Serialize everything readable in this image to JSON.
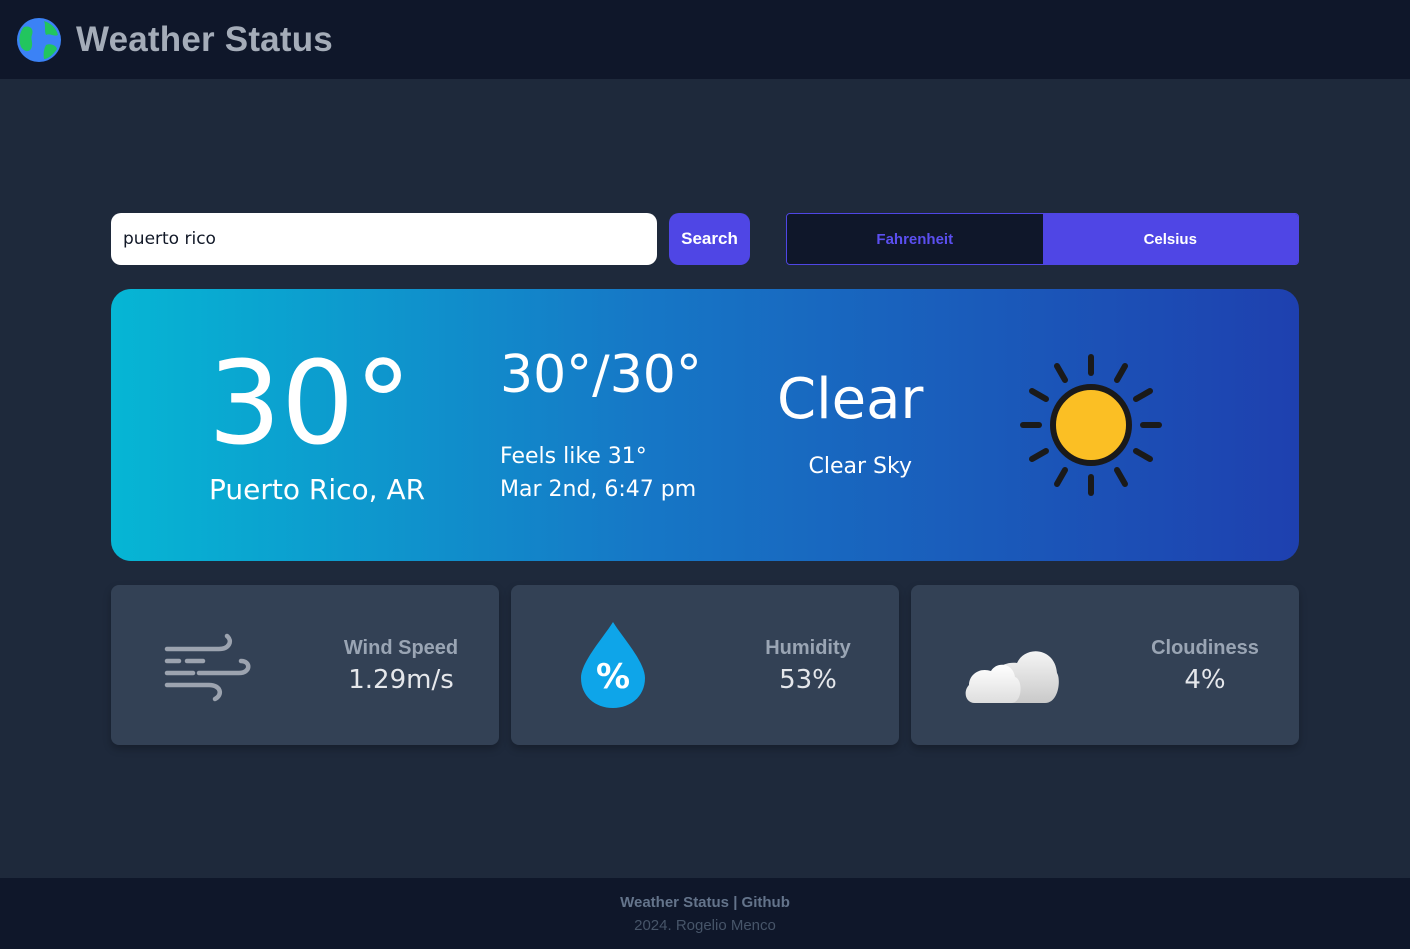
{
  "header": {
    "title": "Weather Status",
    "logo_icon": "globe-icon"
  },
  "search": {
    "value": "puerto rico",
    "button_label": "Search"
  },
  "units": {
    "options": [
      "Fahrenheit",
      "Celsius"
    ],
    "selected": "Celsius"
  },
  "current": {
    "temperature": "30°",
    "location": "Puerto Rico, AR",
    "range": "30°/30°",
    "feels_like": "Feels like 31°",
    "datetime": "Mar 2nd, 6:47 pm",
    "condition": "Clear",
    "condition_detail": "Clear Sky",
    "condition_icon": "sun-icon"
  },
  "stats": [
    {
      "label": "Wind Speed",
      "value": "1.29m/s",
      "icon": "wind-icon"
    },
    {
      "label": "Humidity",
      "value": "53%",
      "icon": "humidity-drop-icon"
    },
    {
      "label": "Cloudiness",
      "value": "4%",
      "icon": "cloud-icon"
    }
  ],
  "footer": {
    "links": "Weather Status | Github",
    "copyright": "2024. Rogelio Menco"
  },
  "colors": {
    "background": "#1e293b",
    "header_bg": "#0f172a",
    "accent": "#4f46e5",
    "card_bg": "#334155",
    "gradient_start": "#06b6d4",
    "gradient_end": "#1e40af",
    "sun": "#fbbf24"
  }
}
